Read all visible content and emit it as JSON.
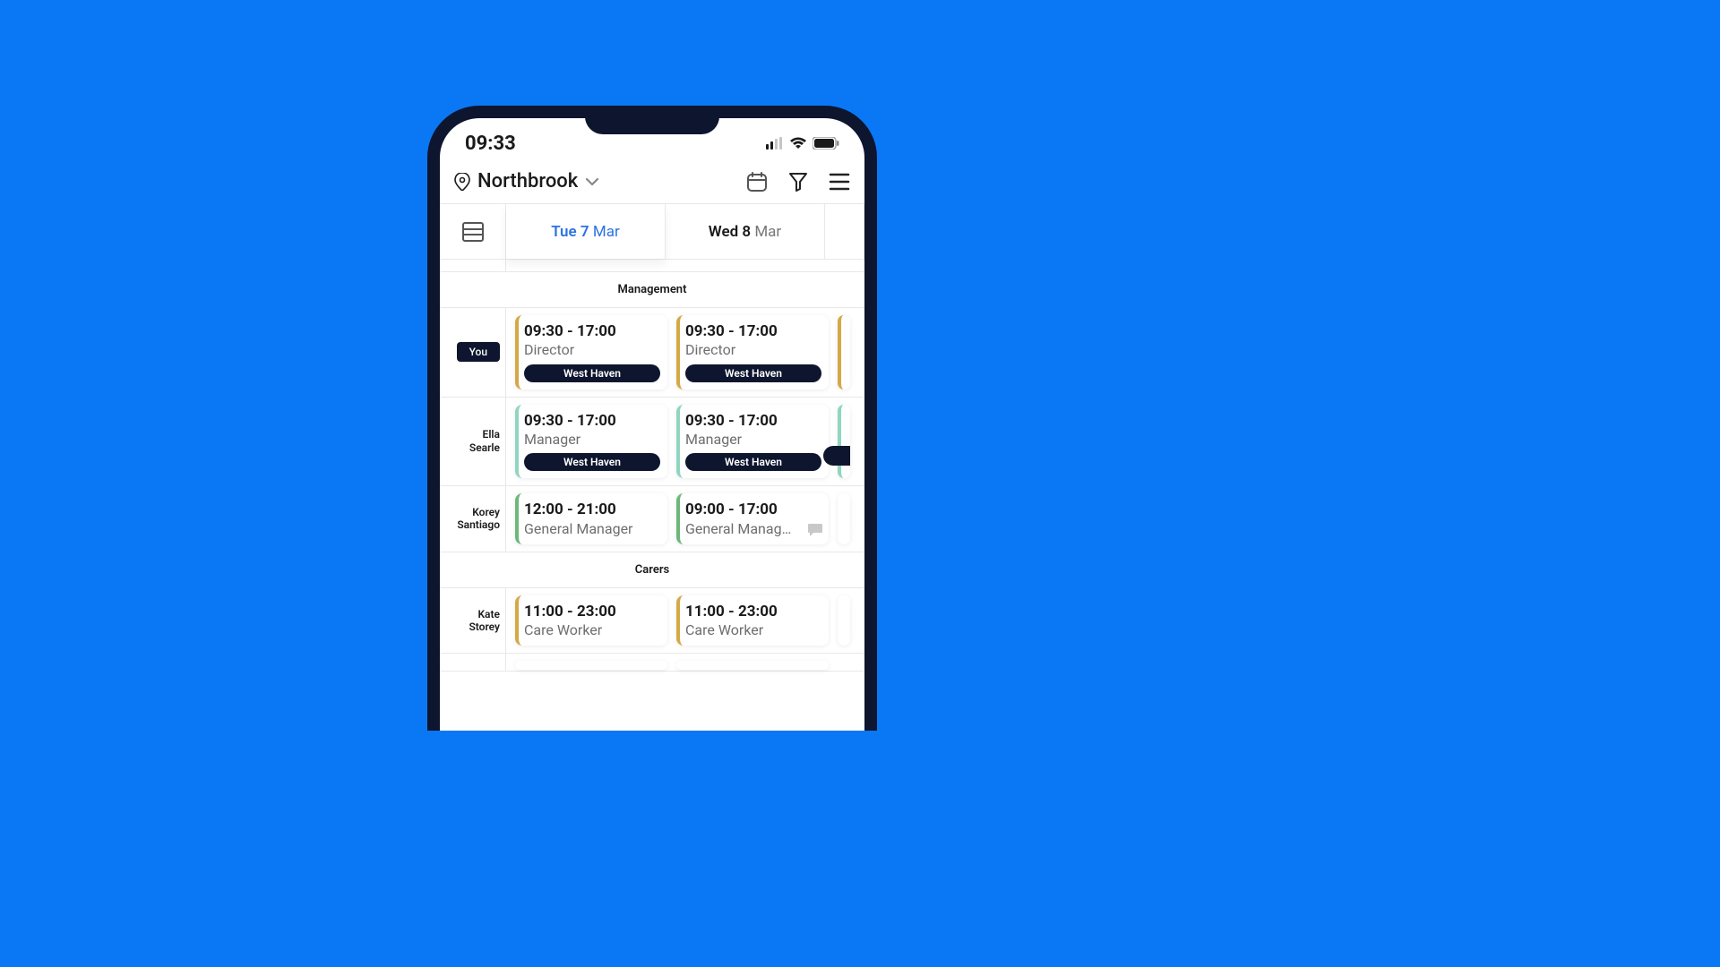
{
  "status": {
    "time": "09:33"
  },
  "header": {
    "location": "Northbrook"
  },
  "tabs": {
    "active": {
      "day": "Tue 7",
      "month": "Mar"
    },
    "next": {
      "day": "Wed 8",
      "month": "Mar"
    }
  },
  "sections": {
    "management": {
      "title": "Management"
    },
    "carers": {
      "title": "Carers"
    }
  },
  "people": {
    "you": {
      "label": "You"
    },
    "ella": {
      "first": "Ella",
      "last": "Searle"
    },
    "korey": {
      "first": "Korey",
      "last": "Santiago"
    },
    "kate": {
      "first": "Kate",
      "last": "Storey"
    }
  },
  "shifts": {
    "you_tue": {
      "time": "09:30 - 17:00",
      "role": "Director",
      "loc": "West Haven"
    },
    "you_wed": {
      "time": "09:30 - 17:00",
      "role": "Director",
      "loc": "West Haven"
    },
    "ella_tue": {
      "time": "09:30 - 17:00",
      "role": "Manager",
      "loc": "West Haven"
    },
    "ella_wed": {
      "time": "09:30 - 17:00",
      "role": "Manager",
      "loc": "West Haven"
    },
    "korey_tue": {
      "time": "12:00 - 21:00",
      "role": "General Manager"
    },
    "korey_wed": {
      "time": "09:00 - 17:00",
      "role": "General Manag…"
    },
    "kate_tue": {
      "time": "11:00 - 23:00",
      "role": "Care Worker"
    },
    "kate_wed": {
      "time": "11:00 - 23:00",
      "role": "Care Worker"
    }
  }
}
